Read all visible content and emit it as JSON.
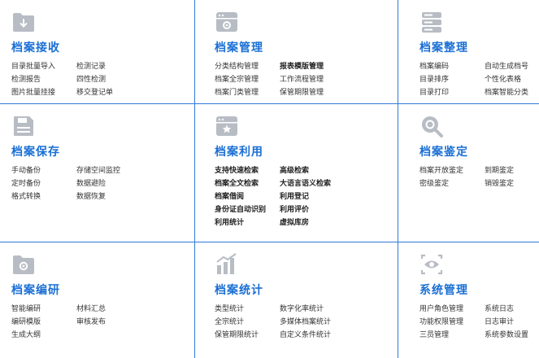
{
  "colors": {
    "accent": "#1a6fd4",
    "icon_gray": "#b8bcc4",
    "border": "#2f7bd6"
  },
  "modules": [
    {
      "title": "档案接收",
      "icon": "folder-download-icon",
      "items": [
        "目录批量导入",
        "检测记录",
        "检测报告",
        "四性检测",
        "图片批量挂接",
        "移交登记单"
      ]
    },
    {
      "title": "档案管理",
      "icon": "window-settings-icon",
      "items": [
        "分类结构管理",
        "报表模版管理",
        "档案全宗管理",
        "工作流程管理",
        "档案门类管理",
        "保管期限管理"
      ]
    },
    {
      "title": "档案整理",
      "icon": "server-stack-icon",
      "items": [
        "档案编码",
        "自动生成档号",
        "目录排序",
        "个性化表格",
        "目录打印",
        "档案智能分类"
      ]
    },
    {
      "title": "档案保存",
      "icon": "floppy-disk-icon",
      "items": [
        "手动备份",
        "存储空间监控",
        "定时备份",
        "数据避险",
        "格式转换",
        "数据恢复"
      ]
    },
    {
      "title": "档案利用",
      "icon": "window-star-icon",
      "items": [
        "支持快速检索",
        "高级检索",
        "档案全文检索",
        "大语言语义检索",
        "档案借阅",
        "利用登记",
        "身份证自动识别",
        "利用评价",
        "利用统计",
        "虚拟库房"
      ]
    },
    {
      "title": "档案鉴定",
      "icon": "search-magnifier-icon",
      "items": [
        "档案开放鉴定",
        "到期鉴定",
        "密级鉴定",
        "销毁鉴定"
      ]
    },
    {
      "title": "档案编研",
      "icon": "folder-gear-icon",
      "items": [
        "智能编研",
        "材料汇总",
        "编研模版",
        "审核发布",
        "生成大纲"
      ]
    },
    {
      "title": "档案统计",
      "icon": "bar-chart-icon",
      "items": [
        "类型统计",
        "数字化率统计",
        "全宗统计",
        "多媒体档案统计",
        "保管期限统计",
        "自定义条件统计"
      ]
    },
    {
      "title": "系统管理",
      "icon": "eye-frame-icon",
      "items": [
        "用户角色管理",
        "系统日志",
        "功能权限管理",
        "日志审计",
        "三员管理",
        "系统参数设置"
      ]
    }
  ]
}
